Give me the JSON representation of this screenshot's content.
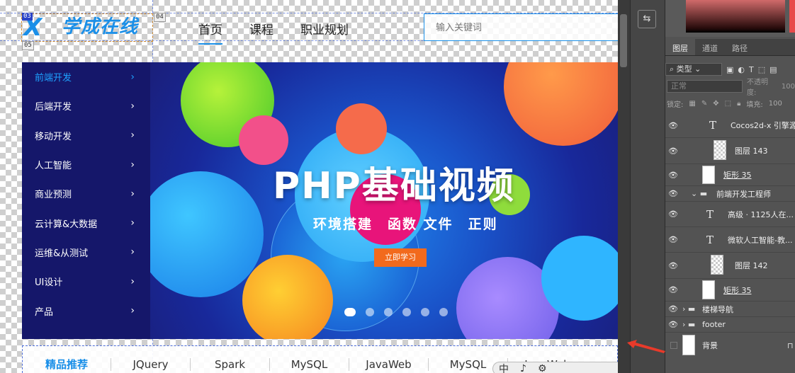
{
  "website": {
    "logo_text": "学成在线",
    "markers": [
      "03",
      "04",
      "05"
    ],
    "nav": [
      "首页",
      "课程",
      "职业规划"
    ],
    "search_placeholder": "输入关键词",
    "sidebar": [
      "前端开发",
      "后端开发",
      "移动开发",
      "人工智能",
      "商业预测",
      "云计算&大数据",
      "运维&从测试",
      "UI设计",
      "产品"
    ],
    "banner": {
      "title": "PHP基础视频",
      "subtitle": "环境搭建　函数  文件　正则",
      "button": "立即学习"
    },
    "recommend": [
      "精品推荐",
      "JQuery",
      "Spark",
      "MySQL",
      "JavaWeb",
      "MySQL",
      "JavaWeb"
    ],
    "ime": [
      "中",
      "♪",
      "⚙"
    ]
  },
  "photoshop": {
    "tabs": [
      "图层",
      "通道",
      "路径"
    ],
    "filter_label": "类型",
    "blend_mode": "正常",
    "opacity_label": "不透明度:",
    "opacity_value": "100",
    "lock_label": "锁定:",
    "fill_label": "填充:",
    "fill_value": "100",
    "layers": [
      {
        "name": "Cocos2d-x 引擎源...",
        "kind": "text"
      },
      {
        "name": "图层 143",
        "kind": "image"
      },
      {
        "name": "矩形 35",
        "kind": "shape"
      },
      {
        "name": "前端开发工程师",
        "kind": "group"
      },
      {
        "name": "高级 · 1125人在...",
        "kind": "text"
      },
      {
        "name": "微软人工智能-教...",
        "kind": "text"
      },
      {
        "name": "图层 142",
        "kind": "image"
      },
      {
        "name": "矩形 35",
        "kind": "shape"
      },
      {
        "name": "楼梯导航",
        "kind": "group"
      },
      {
        "name": "footer",
        "kind": "group"
      },
      {
        "name": "背景",
        "kind": "background"
      }
    ]
  },
  "colors": {
    "accent": "#1a8fe8",
    "sidebar": "#15176a",
    "button": "#f26a1d"
  }
}
